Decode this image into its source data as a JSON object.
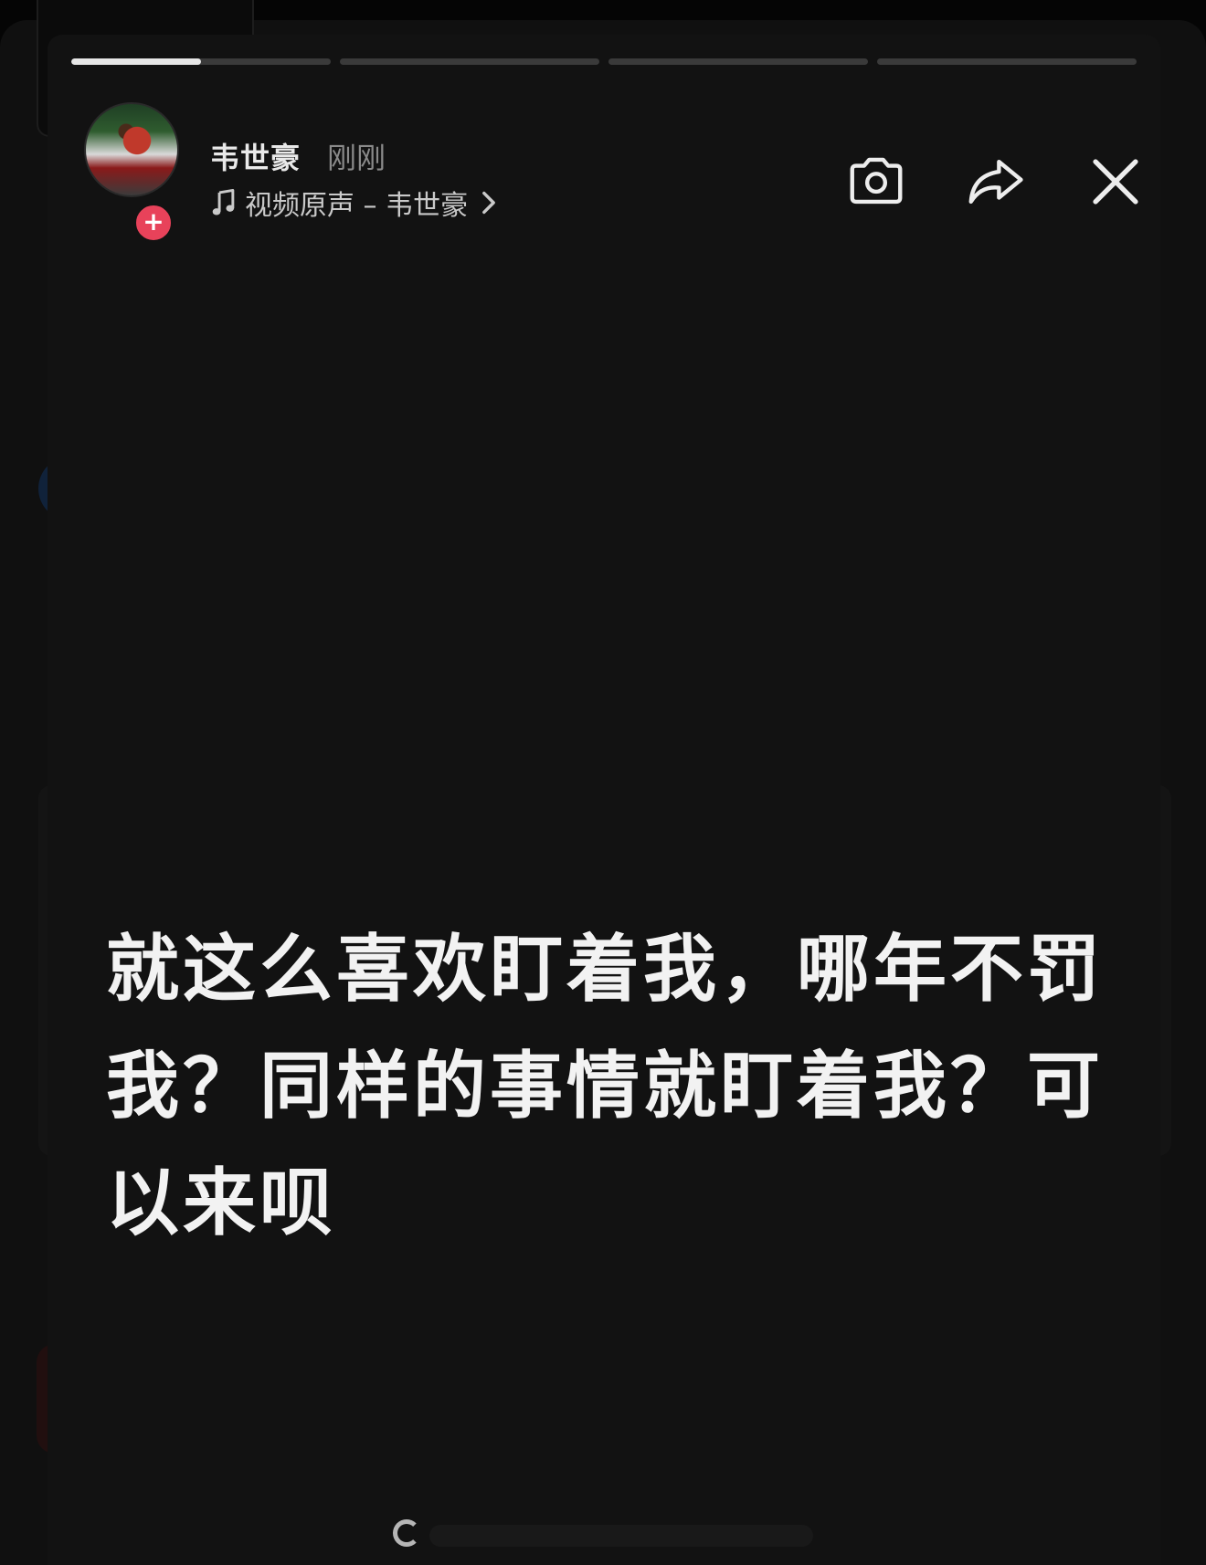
{
  "story": {
    "progress": [
      0.5,
      0,
      0,
      0
    ],
    "author": {
      "name": "韦世豪",
      "time": "刚刚",
      "follow_symbol": "+"
    },
    "music": {
      "label": "视频原声 – 韦世豪",
      "icon": "music-note-icon"
    },
    "controls": {
      "camera_icon": "camera-icon",
      "share_icon": "share-arrow-icon",
      "close_icon": "close-icon"
    },
    "caption": "就这么喜欢盯着我，哪年不罚我？同样的事情就盯着我？可以来呗"
  },
  "colors": {
    "background": "#121212",
    "text": "#f2f2f2",
    "muted": "#8a8a8a",
    "follow_badge": "#e8425a"
  }
}
